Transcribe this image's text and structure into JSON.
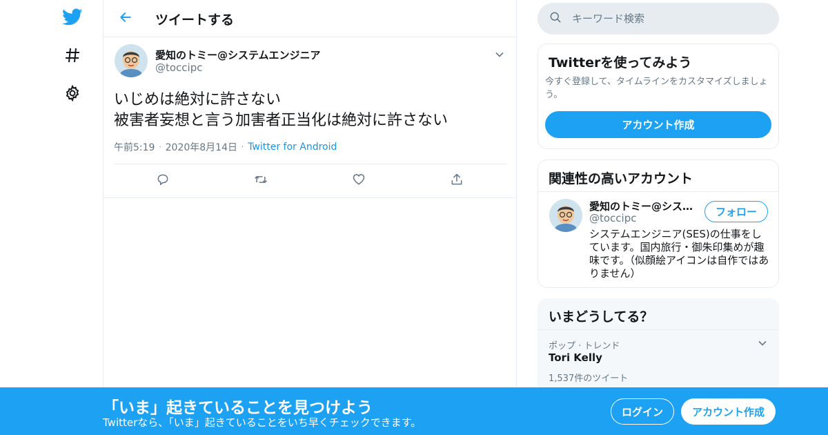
{
  "colors": {
    "accent": "#1da1f2",
    "link": "#1b95e0",
    "muted_text": "#657786",
    "border": "#e6ecf0",
    "icon_blue": "#1da1f2",
    "icon_dark": "#14171a"
  },
  "leftnav": {
    "items": [
      {
        "icon": "twitter-bird-icon"
      },
      {
        "icon": "hashtag-icon"
      },
      {
        "icon": "gear-icon"
      }
    ]
  },
  "header": {
    "back_icon": "back-arrow-icon",
    "title": "ツイートする"
  },
  "tweet": {
    "author_name": "愛知のトミー@システムエンジニア",
    "author_handle": "@toccipc",
    "text": "いじめは絶対に許さない\n被害者妄想と言う加害者正当化は絶対に許さない",
    "time": "午前5:19",
    "date": "2020年8月14日",
    "source": "Twitter for Android",
    "actions": [
      "reply-icon",
      "retweet-icon",
      "like-icon",
      "share-icon"
    ]
  },
  "search": {
    "placeholder": "キーワード検索"
  },
  "signup_panel": {
    "title": "Twitterを使ってみよう",
    "description": "今すぐ登録して、タイムラインをカスタマイズしましょう。",
    "button_label": "アカウント作成"
  },
  "related_panel": {
    "title": "関連性の高いアカウント",
    "account": {
      "name": "愛知のトミー@システムエンジニア",
      "handle": "@toccipc",
      "follow_label": "フォロー",
      "bio": "システムエンジニア(SES)の仕事をしています。国内旅行・御朱印集めが趣味です。（似顔絵アイコンは自作ではありません）"
    }
  },
  "trends_panel": {
    "title": "いまどうしてる？",
    "trend": {
      "category": "ポップ · トレンド",
      "name": "Tori Kelly",
      "count": "1,537件のツイート"
    }
  },
  "banner": {
    "title": "「いま」起きていることを見つけよう",
    "subtitle": "Twitterなら、「いま」起きていることをいち早くチェックできます。",
    "login_label": "ログイン",
    "signup_label": "アカウント作成"
  }
}
